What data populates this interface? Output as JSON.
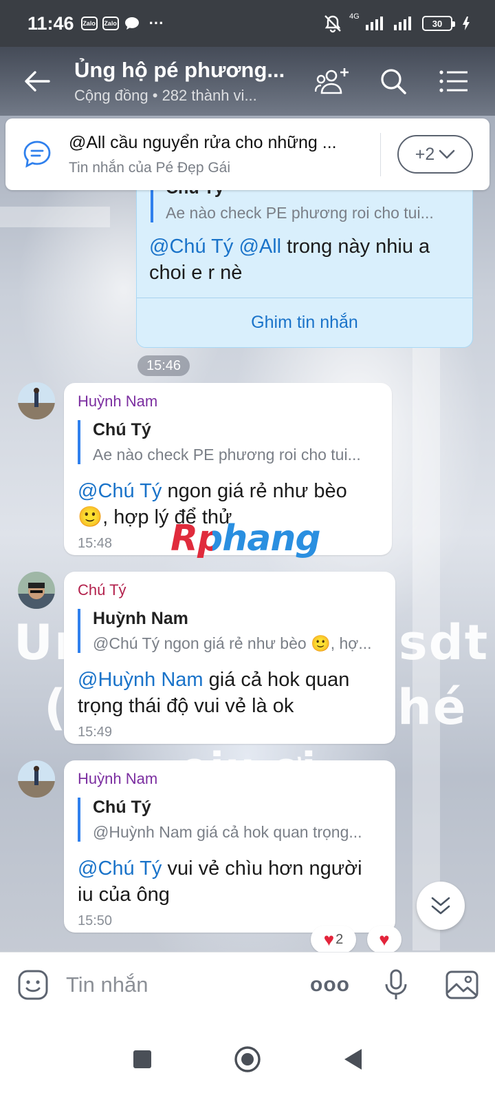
{
  "status_bar": {
    "time": "11:46",
    "notif_app_1": "Zalo",
    "notif_app_2": "Zalo",
    "more": "···",
    "network": "4G",
    "battery": "30"
  },
  "header": {
    "title": "Ủng hộ pé phương...",
    "subtitle": "Cộng đồng • 282 thành vi..."
  },
  "pinned": {
    "message": "@All cầu nguyển rửa cho những ...",
    "author_line": "Tin nhắn của Pé Đẹp Gái",
    "more_count": "+2"
  },
  "own_message": {
    "quote_name": "Chú Tý",
    "quote_text": "Ae nào check PE phương roi cho tui...",
    "mention_1": "@Chú Tý",
    "mention_2": "@All",
    "text": " trong này nhiu a choi e r nè",
    "pin_action": "Ghim tin nhắn",
    "time": "15:46"
  },
  "messages": [
    {
      "sender": "Huỳnh Nam",
      "quote_name": "Chú Tý",
      "quote_text": "Ae nào check PE phương roi cho tui...",
      "mention": "@Chú Tý",
      "text": " ngon giá rẻ như bèo 🙂, hợp lý để thử",
      "time": "15:48"
    },
    {
      "sender": "Chú Tý",
      "quote_name": "Huỳnh Nam",
      "quote_text": "@Chú Tý ngon giá rẻ như bèo 🙂, hợ...",
      "mention": "@Huỳnh Nam",
      "text": " giá cả hok quan trọng thái độ vui vẻ là ok",
      "time": "15:49"
    },
    {
      "sender": "Huỳnh Nam",
      "quote_name": "Chú Tý",
      "quote_text": "@Huỳnh Nam giá cả hok quan trọng...",
      "mention": "@Chú Tý",
      "text": " vui vẻ chìu hơn người iu của ông",
      "time": "15:50"
    }
  ],
  "reactions": {
    "heart_count": "2"
  },
  "wallpaper_text": {
    "line1_left": "Ur",
    "line1_right": "sdt",
    "line2_left": "(",
    "line2_right": "hé",
    "line3": "oiu ơi"
  },
  "watermark": "Rphang",
  "input": {
    "placeholder": "Tin nhắn",
    "more": "ooo"
  },
  "colors": {
    "accent": "#1a73c9",
    "own_bubble": "#d9effc",
    "heart": "#e3243b",
    "sender_purple": "#7b2ea0",
    "sender_red": "#b3224d"
  }
}
